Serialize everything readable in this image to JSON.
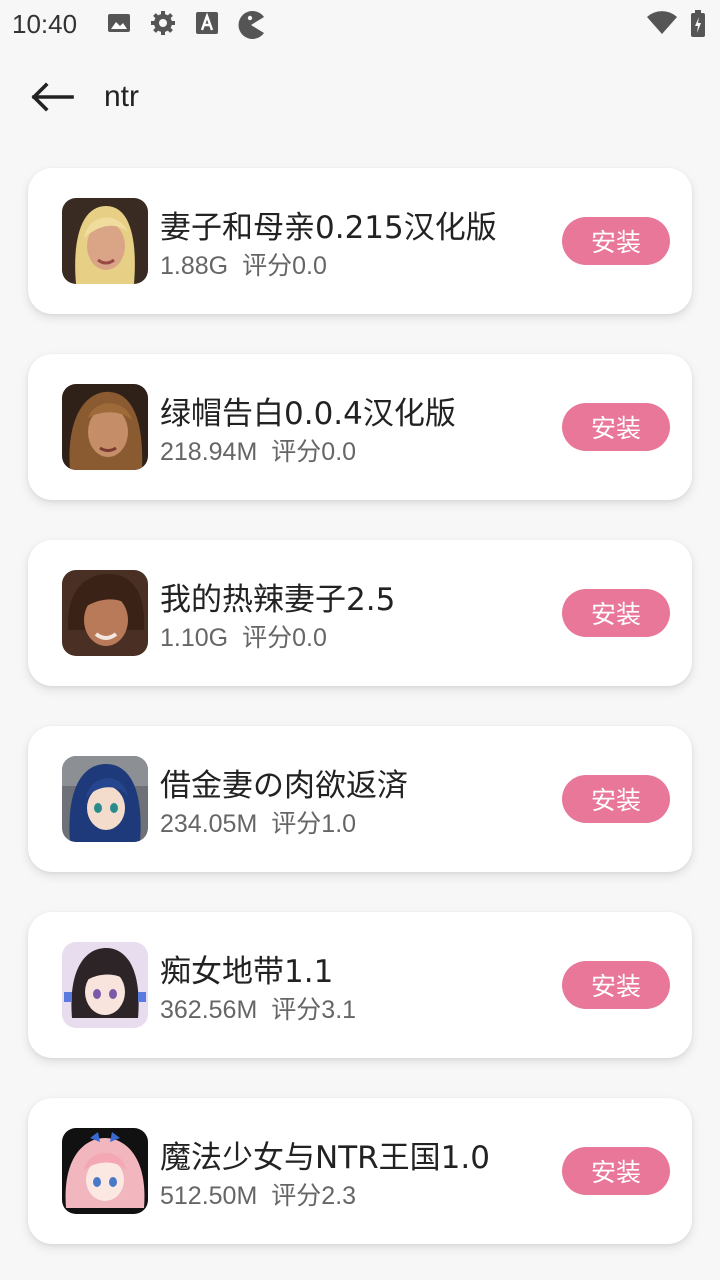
{
  "status_bar": {
    "time": "10:40"
  },
  "search": {
    "query": "ntr"
  },
  "apps": [
    {
      "name": "妻子和母亲0.215汉化版",
      "size": "1.88G",
      "rating": "评分0.0",
      "install_label": "安装"
    },
    {
      "name": "绿帽告白0.0.4汉化版",
      "size": "218.94M",
      "rating": "评分0.0",
      "install_label": "安装"
    },
    {
      "name": "我的热辣妻子2.5",
      "size": "1.10G",
      "rating": "评分0.0",
      "install_label": "安装"
    },
    {
      "name": "借金妻の肉欲返済",
      "size": "234.05M",
      "rating": "评分1.0",
      "install_label": "安装"
    },
    {
      "name": "痴女地带1.1",
      "size": "362.56M",
      "rating": "评分3.1",
      "install_label": "安装"
    },
    {
      "name": "魔法少女与NTR王国1.0",
      "size": "512.50M",
      "rating": "评分2.3",
      "install_label": "安装"
    }
  ],
  "colors": {
    "accent": "#e8779a",
    "background": "#f7f7f7",
    "card": "#ffffff"
  }
}
